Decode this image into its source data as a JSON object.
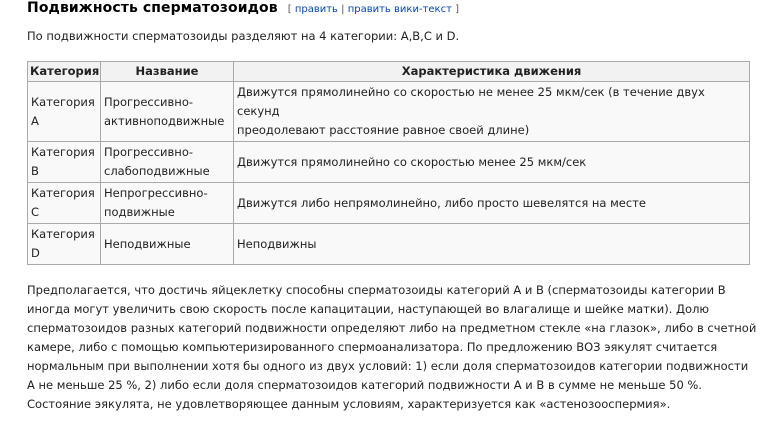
{
  "section": {
    "title": "Подвижность сперматозоидов",
    "edit_open": "[",
    "edit_link": "править",
    "edit_sep": "|",
    "edit_wiki_link": "править вики-текст",
    "edit_close": "]"
  },
  "intro": "По подвижности сперматозоиды разделяют на 4 категории: A,B,C и D.",
  "table": {
    "headers": [
      "Категория",
      "Название",
      "Характеристика движения"
    ],
    "rows": [
      {
        "category": [
          "Категория",
          "A"
        ],
        "name": [
          "Прогрессивно-",
          "активноподвижные"
        ],
        "desc": [
          "Движутся прямолинейно со скоростью не менее 25 мкм/сек (в течение двух секунд",
          "преодолевают расстояние равное своей длине)"
        ]
      },
      {
        "category": [
          "Категория",
          "B"
        ],
        "name": [
          "Прогрессивно-",
          "слабоподвижные"
        ],
        "desc": [
          "Движутся прямолинейно со скоростью менее 25 мкм/сек"
        ]
      },
      {
        "category": [
          "Категория",
          "C"
        ],
        "name": [
          "Непрогрессивно-",
          "подвижные"
        ],
        "desc": [
          "Движутся либо непрямолинейно, либо просто шевелятся на месте"
        ]
      },
      {
        "category": [
          "Категория",
          "D"
        ],
        "name": [
          "Неподвижные"
        ],
        "desc": [
          "Неподвижны"
        ]
      }
    ]
  },
  "paragraph": [
    "Предполагается, что достичь яйцеклетку способны сперматозоиды категорий A и B (сперматозоиды категории B",
    "иногда могут увеличить свою скорость после капацитации, наступающей во влагалище и шейке матки). Долю",
    "сперматозоидов разных категорий подвижности определяют либо на предметном стекле «на глазок», либо в счетной",
    "камере, либо с помощью компьютеризированного спермоанализатора. По предложению ВОЗ эякулят считается",
    "нормальным при выполнении хотя бы одного из двух условий: 1) если доля сперматозоидов категории подвижности",
    "A не меньше 25 %, 2) либо если доля сперматозоидов категорий подвижности A и B в сумме не меньше 50 %.",
    "Состояние эякулята, не удовлетворяющее данным условиям, характеризуется как «астенозооспермия»."
  ],
  "colors": {
    "link": "#0645ad",
    "border": "#aaaaaa",
    "header_bg": "#f2f2f2",
    "cell_bg": "#f9f9f9"
  }
}
